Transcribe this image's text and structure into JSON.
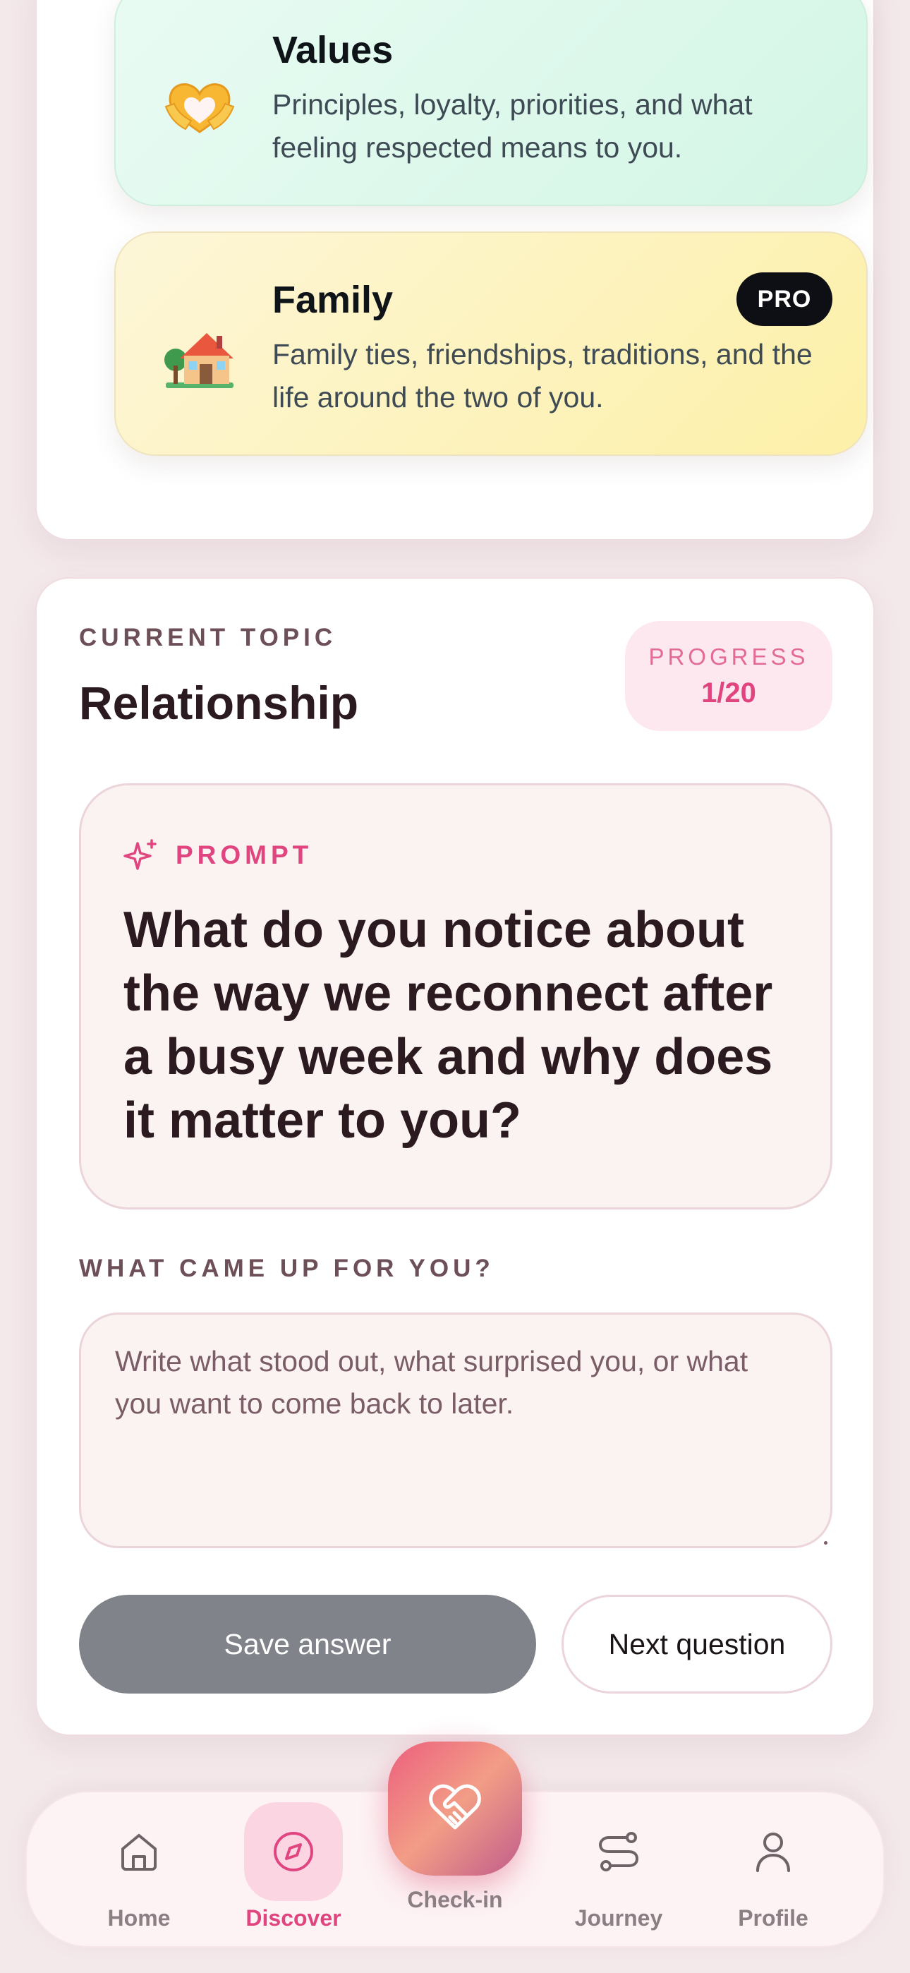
{
  "categories": [
    {
      "title": "Values",
      "description": "Principles, loyalty, priorities, and what feeling respected means to you.",
      "icon": "heart-hands-icon",
      "pro": false
    },
    {
      "title": "Family",
      "description": "Family ties, friendships, traditions, and the life around the two of you.",
      "icon": "house-icon",
      "pro": true,
      "badge": "PRO"
    }
  ],
  "topic": {
    "eyebrow": "CURRENT TOPIC",
    "title": "Relationship",
    "progress_label": "PROGRESS",
    "progress_value": "1/20"
  },
  "prompt": {
    "label": "PROMPT",
    "icon": "sparkle-icon",
    "question": "What do you notice about the way we reconnect after a busy week and why does it matter to you?"
  },
  "answer": {
    "label": "WHAT CAME UP FOR YOU?",
    "placeholder": "Write what stood out, what surprised you, or what you want to come back to later.",
    "value": ""
  },
  "actions": {
    "save_label": "Save answer",
    "next_label": "Next question"
  },
  "nav": {
    "items": [
      {
        "label": "Home",
        "icon": "home-icon",
        "active": false
      },
      {
        "label": "Discover",
        "icon": "compass-icon",
        "active": true
      },
      {
        "label": "Check-in",
        "icon": "heart-handshake-icon",
        "active": false
      },
      {
        "label": "Journey",
        "icon": "route-icon",
        "active": false
      },
      {
        "label": "Profile",
        "icon": "user-icon",
        "active": false
      }
    ]
  },
  "colors": {
    "accent": "#e0457f",
    "page_bg": "#f3e8ea",
    "values_card": "#d3f6e5",
    "family_card": "#fdf0a8",
    "save_button": "#808389"
  }
}
